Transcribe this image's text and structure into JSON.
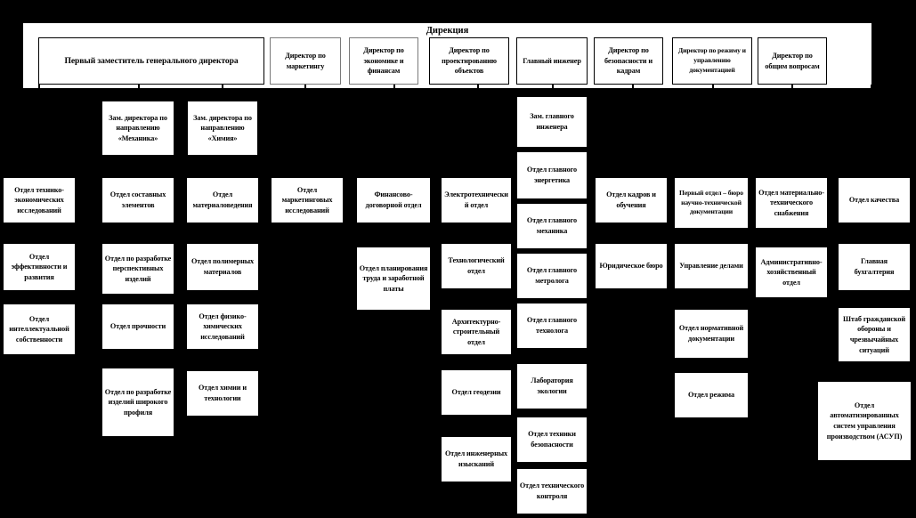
{
  "board": {
    "title": "Дирекция",
    "background": "#000000",
    "node_fill": "#ffffff",
    "node_stroke": "#000000"
  },
  "directorate": {
    "title": "Дирекция",
    "members": [
      {
        "label": "Первый заместитель генерального директора"
      },
      {
        "label": "Директор по маркетингу"
      },
      {
        "label": "Директор по экономике и финансам"
      },
      {
        "label": "Директор по проектированию объектов"
      },
      {
        "label": "Главный инженер"
      },
      {
        "label": "Директор по безопасности и кадрам"
      },
      {
        "label": "Директор по режиму и управлению документацией"
      },
      {
        "label": "Директор по общим вопросам"
      }
    ]
  },
  "deputies": [
    {
      "label": "Зам. директора по направлению «Механика»"
    },
    {
      "label": "Зам. директора по направлению «Химия»"
    },
    {
      "label": "Зам. главного инженера"
    }
  ],
  "columns": [
    {
      "name": "column-economics",
      "items": [
        {
          "label": "Отдел технико-экономических исследований"
        },
        {
          "label": "Отдел эффективности и развития"
        },
        {
          "label": "Отдел интеллектуальной собственности"
        }
      ]
    },
    {
      "name": "column-mechanics",
      "items": [
        {
          "label": "Отдел составных элементов"
        },
        {
          "label": "Отдел по разработке перспективных изделий"
        },
        {
          "label": "Отдел прочности"
        },
        {
          "label": "Отдел по разработке изделий широкого профиля"
        }
      ]
    },
    {
      "name": "column-chemistry",
      "items": [
        {
          "label": "Отдел материаловедения"
        },
        {
          "label": "Отдел полимерных материалов"
        },
        {
          "label": "Отдел физико-химических исследований"
        },
        {
          "label": "Отдел химии и технологии"
        }
      ]
    },
    {
      "name": "column-marketing",
      "items": [
        {
          "label": "Отдел маркетинговых исследований"
        }
      ]
    },
    {
      "name": "column-finance",
      "items": [
        {
          "label": "Финансово-договорной отдел"
        },
        {
          "label": "Отдел планирования труда и заработной платы"
        }
      ]
    },
    {
      "name": "column-design",
      "items": [
        {
          "label": "Электротехнический отдел"
        },
        {
          "label": "Технологический отдел"
        },
        {
          "label": "Архитектурно-строительный отдел"
        },
        {
          "label": "Отдел геодезии"
        },
        {
          "label": "Отдел инженерных изысканий"
        }
      ]
    },
    {
      "name": "column-chief-engineer",
      "items": [
        {
          "label": "Отдел главного энергетика"
        },
        {
          "label": "Отдел главного механика"
        },
        {
          "label": "Отдел главного метролога"
        },
        {
          "label": "Отдел главного технолога"
        },
        {
          "label": "Лаборатория экологии"
        },
        {
          "label": "Отдел техники безопасности"
        },
        {
          "label": "Отдел технического контроля"
        }
      ]
    },
    {
      "name": "column-hr",
      "items": [
        {
          "label": "Отдел кадров и обучения"
        },
        {
          "label": "Юридическое бюро"
        }
      ]
    },
    {
      "name": "column-documentation",
      "items": [
        {
          "label": "Первый отдел – бюро научно-технической документации"
        },
        {
          "label": "Управление делами"
        },
        {
          "label": "Отдел нормативной документации"
        },
        {
          "label": "Отдел режима"
        }
      ]
    },
    {
      "name": "column-supply",
      "items": [
        {
          "label": "Отдел материально-технического снабжения"
        },
        {
          "label": "Административно-хозяйственный отдел"
        }
      ]
    },
    {
      "name": "column-quality",
      "items": [
        {
          "label": "Отдел качества"
        },
        {
          "label": "Главная бухгалтерия"
        },
        {
          "label": "Штаб гражданской обороны и чрезвычайных ситуаций"
        },
        {
          "label": "Отдел автоматизированных систем управления производством (АСУП)"
        }
      ]
    }
  ]
}
